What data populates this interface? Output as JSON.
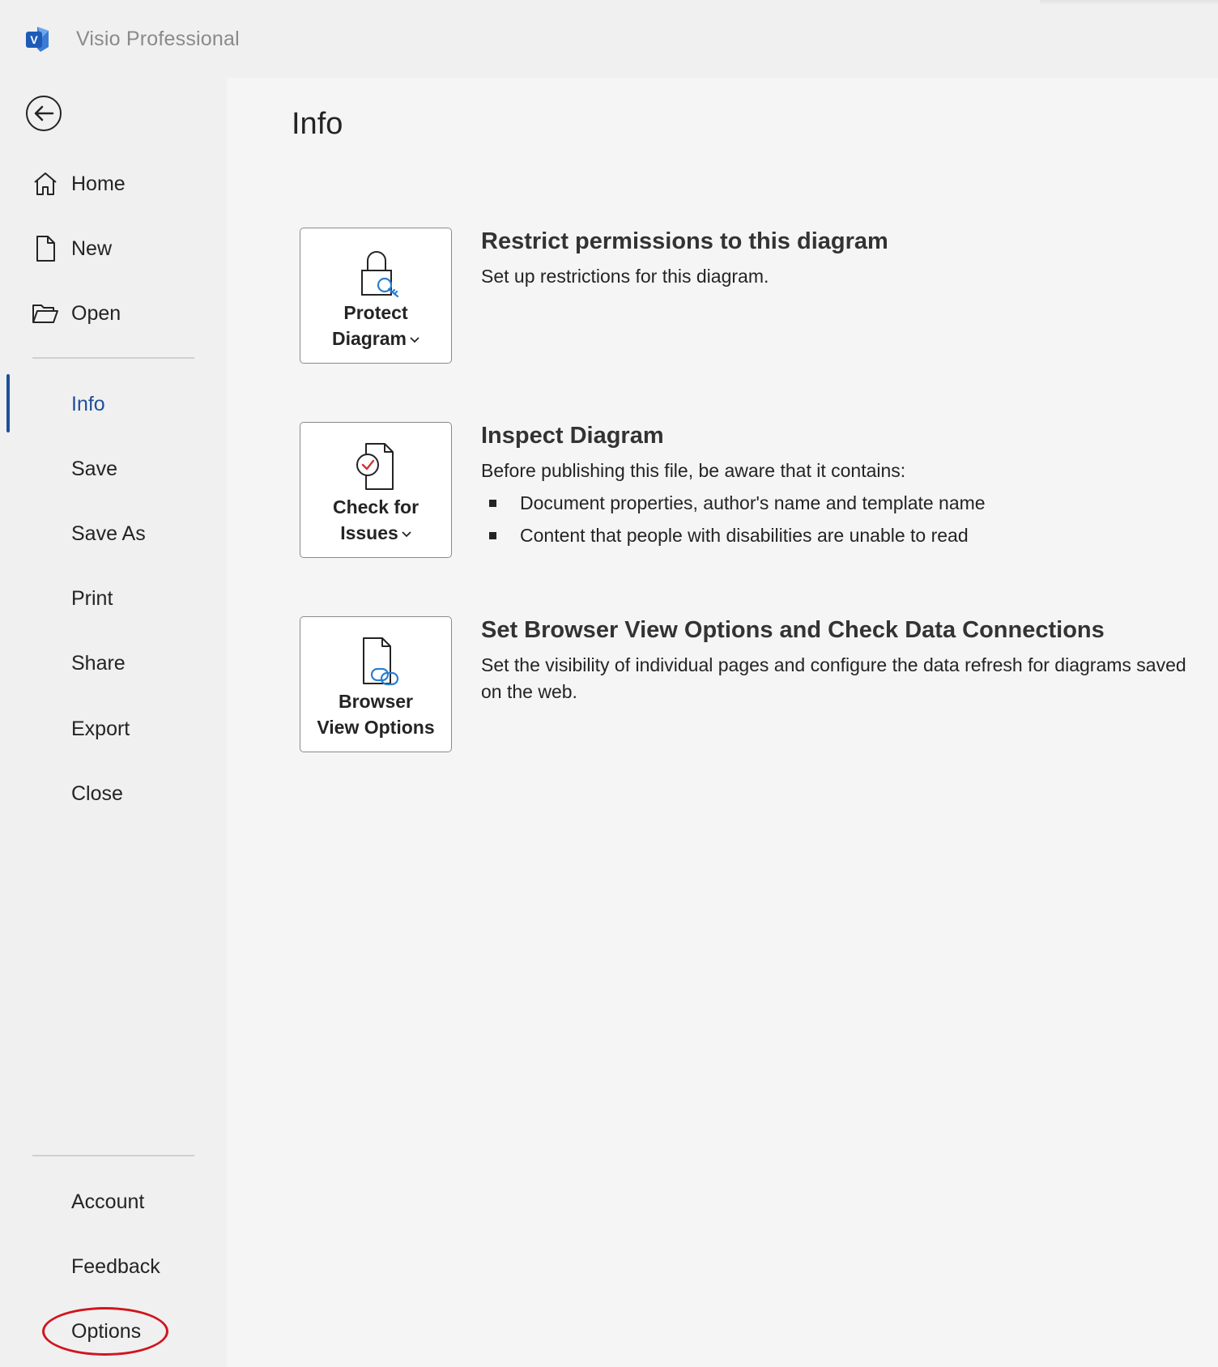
{
  "app": {
    "title": "Visio Professional"
  },
  "sidebar": {
    "nav_top": [
      {
        "label": "Home",
        "icon": "home-icon"
      },
      {
        "label": "New",
        "icon": "new-file-icon"
      },
      {
        "label": "Open",
        "icon": "folder-open-icon"
      }
    ],
    "nav_middle": [
      {
        "label": "Info",
        "active": true
      },
      {
        "label": "Save"
      },
      {
        "label": "Save As"
      },
      {
        "label": "Print"
      },
      {
        "label": "Share"
      },
      {
        "label": "Export"
      },
      {
        "label": "Close"
      }
    ],
    "nav_bottom": [
      {
        "label": "Account"
      },
      {
        "label": "Feedback"
      },
      {
        "label": "Options",
        "highlighted": true
      }
    ]
  },
  "main": {
    "title": "Info",
    "sections": [
      {
        "button_line1": "Protect",
        "button_line2": "Diagram",
        "icon": "lock-key-icon",
        "heading": "Restrict permissions to this diagram",
        "text": "Set up restrictions for this diagram."
      },
      {
        "button_line1": "Check for",
        "button_line2": "Issues",
        "icon": "check-document-icon",
        "heading": "Inspect Diagram",
        "text": "Before publishing this file, be aware that it contains:",
        "bullets": [
          "Document properties, author's name and template name",
          "Content that people with disabilities are unable to read"
        ]
      },
      {
        "button_line1": "Browser",
        "button_line2": "View Options",
        "icon": "document-link-icon",
        "heading": "Set Browser View Options and Check Data Connections",
        "text": "Set the visibility of individual pages and configure the data refresh for diagrams saved on the web."
      }
    ]
  },
  "colors": {
    "accent": "#1f4f9c",
    "highlight_circle": "#d0151f",
    "sidebar_bg": "#f0f0f0",
    "main_bg": "#f5f5f5"
  }
}
